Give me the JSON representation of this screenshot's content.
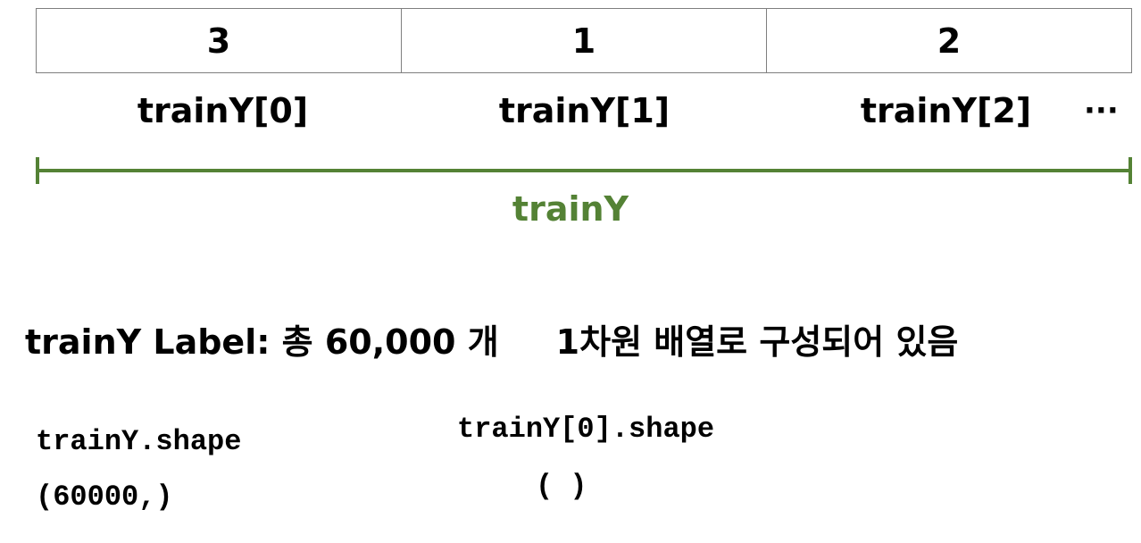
{
  "array": {
    "values": [
      "3",
      "1",
      "2"
    ],
    "index_labels": [
      "trainY[0]",
      "trainY[1]",
      "trainY[2]"
    ],
    "ellipsis": "···"
  },
  "range": {
    "label": "trainY",
    "color": "#548235"
  },
  "summary": {
    "count_text": "trainY Label: 총 60,000 개",
    "structure_text": "1차원 배열로 구성되어 있음"
  },
  "code": {
    "left_expr": "trainY.shape",
    "left_result": "(60000,)",
    "right_expr": "trainY[0].shape",
    "right_result": "( )"
  }
}
